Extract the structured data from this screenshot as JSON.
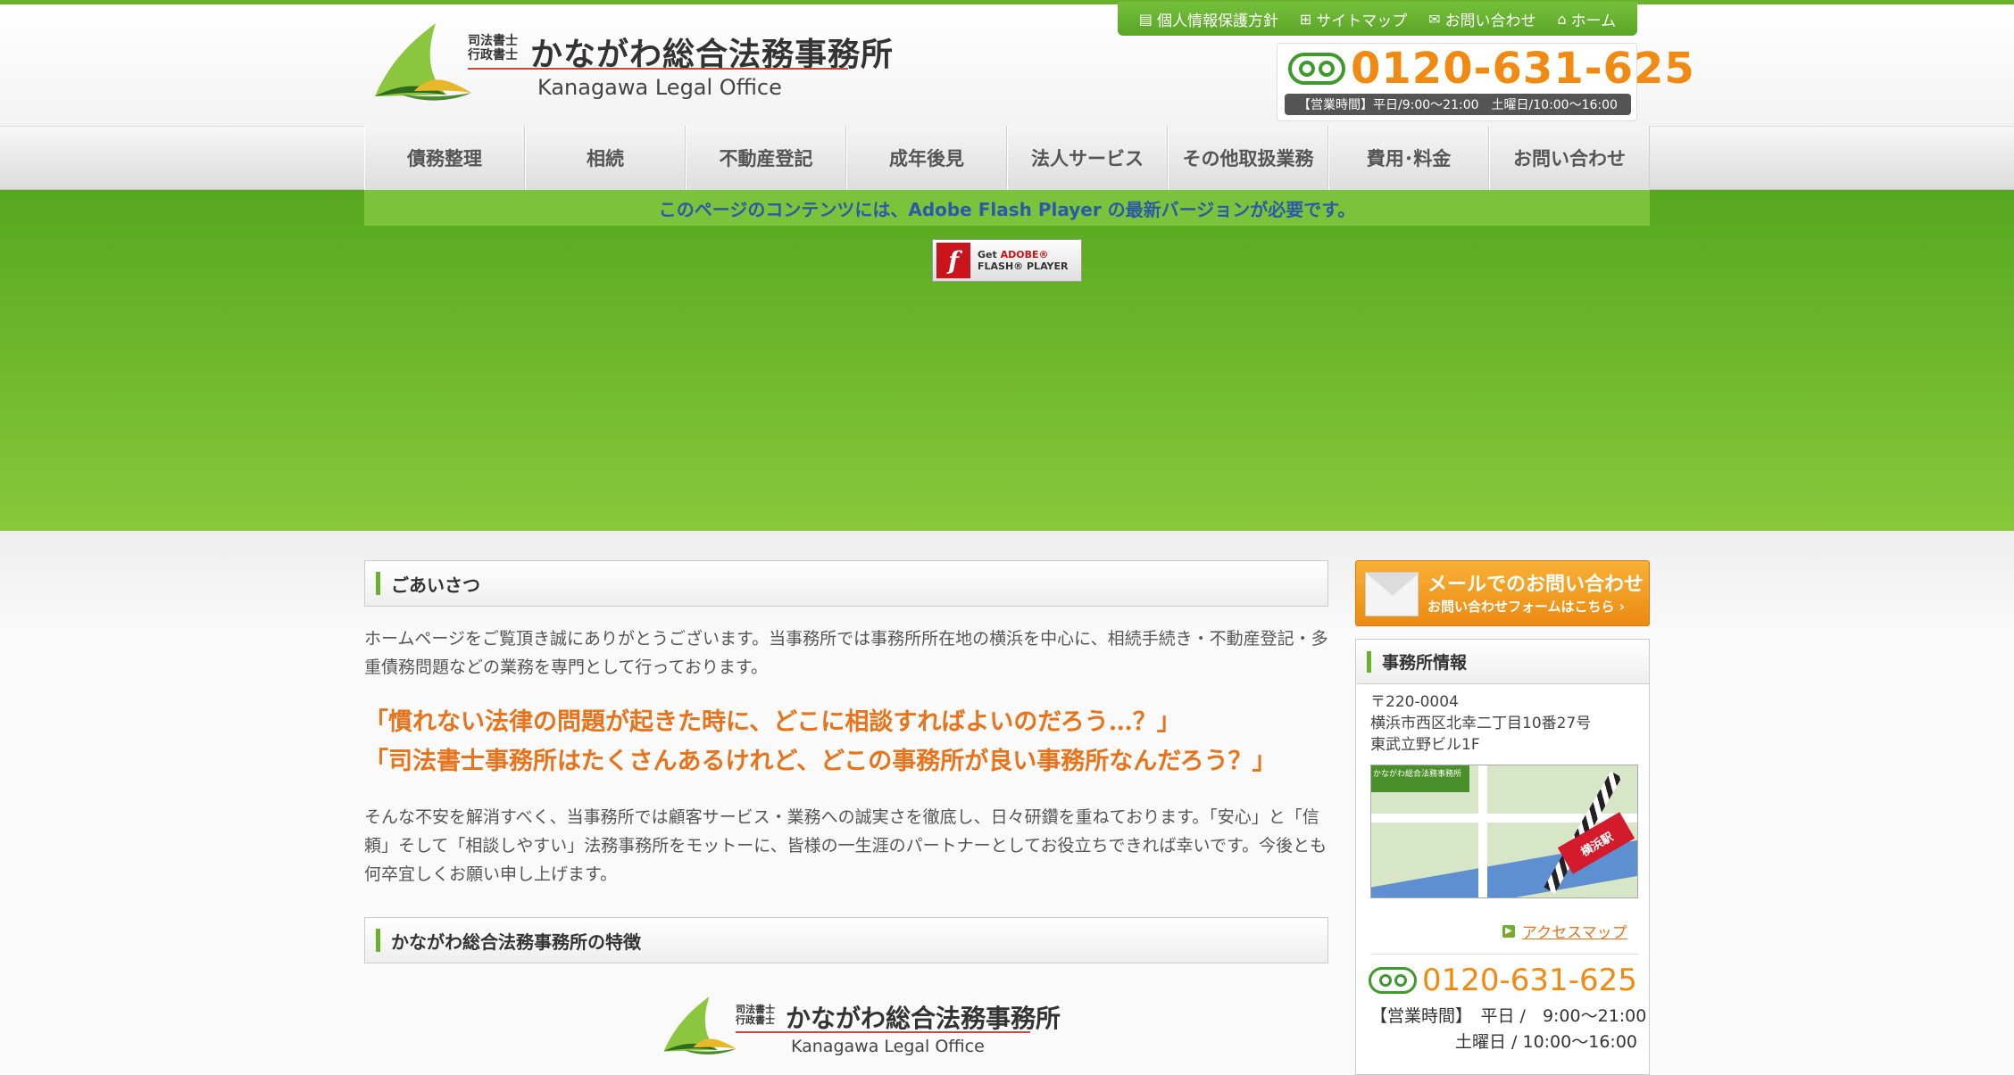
{
  "brand": {
    "qual_line1": "司法書士",
    "qual_line2": "行政書士",
    "name_jp": "かながわ総合法務事務所",
    "name_en": "Kanagawa Legal Office"
  },
  "utility_links": [
    {
      "label": "個人情報保護方針",
      "icon": "document-icon"
    },
    {
      "label": "サイトマップ",
      "icon": "sitemap-icon"
    },
    {
      "label": "お問い合わせ",
      "icon": "mail-icon"
    },
    {
      "label": "ホーム",
      "icon": "home-icon"
    }
  ],
  "phone": {
    "number": "0120-631-625",
    "hours": "【営業時間】平日/9:00～21:00　土曜日/10:00～16:00"
  },
  "nav": [
    "債務整理",
    "相続",
    "不動産登記",
    "成年後見",
    "法人サービス",
    "その他取扱業務",
    "費用･料金",
    "お問い合わせ"
  ],
  "hero": {
    "flash_message": "このページのコンテンツには、Adobe Flash Player の最新バージョンが必要です。",
    "flash_button_line1": "Get",
    "flash_button_brand": "ADOBE®",
    "flash_button_line2": "FLASH® PLAYER"
  },
  "greeting": {
    "title": "ごあいさつ",
    "intro": "ホームページをご覧頂き誠にありがとうございます。当事務所では事務所所在地の横浜を中心に、相続手続き・不動産登記・多重債務問題などの業務を専門として行っております。",
    "catch1": "「慣れない法律の問題が起きた時に、どこに相談すればよいのだろう…？」",
    "catch2": "「司法書士事務所はたくさんあるけれど、どこの事務所が良い事務所なんだろう？」",
    "body": "そんな不安を解消すべく、当事務所では顧客サービス・業務への誠実さを徹底し、日々研鑽を重ねております。「安心」と「信頼」そして「相談しやすい」法務事務所をモットーに、皆様の一生涯のパートナーとしてお役立ちできれば幸いです。今後とも何卒宜しくお願い申し上げます。"
  },
  "features": {
    "title": "かながわ総合法務事務所の特徴"
  },
  "sidebar": {
    "mail_title": "メールでのお問い合わせ",
    "mail_sub": "お問い合わせフォームはこちら ›",
    "office_title": "事務所情報",
    "postal": "〒220-0004",
    "address1": "横浜市西区北幸二丁目10番27号",
    "address2": "東武立野ビル1F",
    "map_label": "かながわ総合法務事務所",
    "map_station": "横浜駅",
    "access_link": "アクセスマップ",
    "phone": "0120-631-625",
    "hours_line1": "【営業時間】　平日 /　9:00～21:00",
    "hours_line2": "　　　　　土曜日 / 10:00～16:00"
  },
  "colors": {
    "green": "#6ab22c",
    "orange": "#f08a12",
    "flash_text": "#2b5aa8"
  }
}
